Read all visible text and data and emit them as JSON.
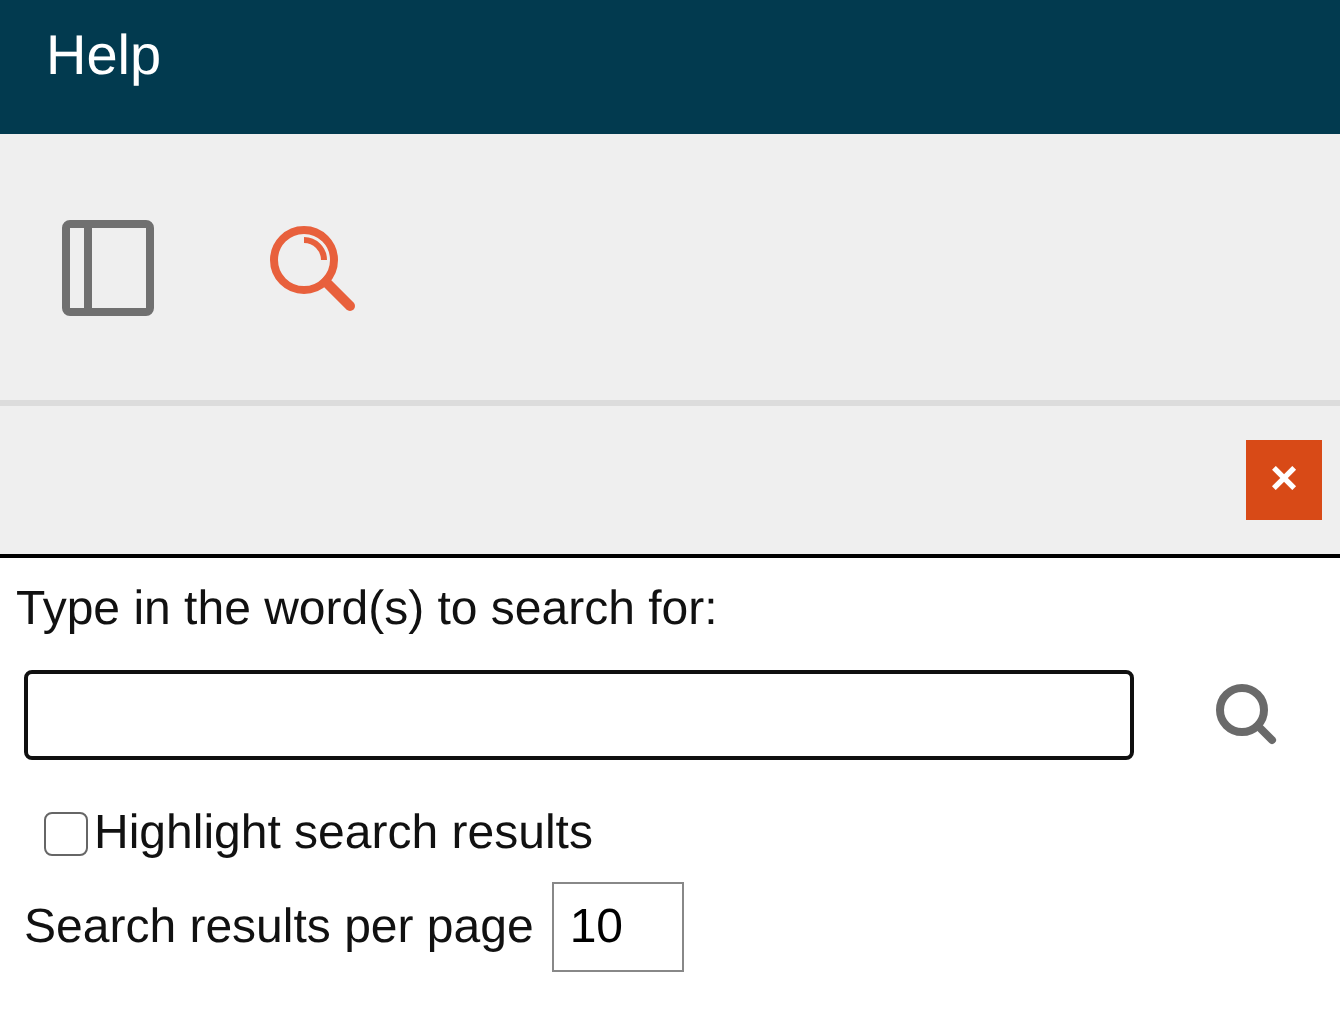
{
  "window": {
    "title": "Help"
  },
  "toolbar": {
    "tabs": [
      {
        "kind": "contents",
        "selected": false
      },
      {
        "kind": "search",
        "selected": true
      }
    ]
  },
  "panel": {
    "close_label": "×"
  },
  "search": {
    "prompt": "Type in the word(s) to search for:",
    "highlight": {
      "label": "Highlight search results",
      "checked": false
    },
    "per_page": {
      "label": "Search results per page",
      "value": "10"
    }
  }
}
